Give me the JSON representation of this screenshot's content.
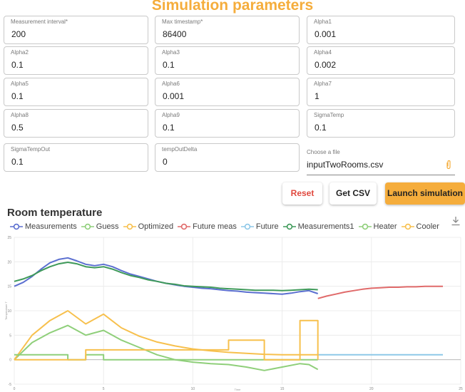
{
  "header": {
    "title": "Simulation parameters"
  },
  "fields": [
    {
      "label": "Measurement interval*",
      "value": "200"
    },
    {
      "label": "Max timestamp*",
      "value": "86400"
    },
    {
      "label": "Alpha1",
      "value": "0.001"
    },
    {
      "label": "Alpha2",
      "value": "0.1"
    },
    {
      "label": "Alpha3",
      "value": "0.1"
    },
    {
      "label": "Alpha4",
      "value": "0.002"
    },
    {
      "label": "Alpha5",
      "value": "0.1"
    },
    {
      "label": "Alpha6",
      "value": "0.001"
    },
    {
      "label": "Alpha7",
      "value": "1"
    },
    {
      "label": "Alpha8",
      "value": "0.5"
    },
    {
      "label": "Alpha9",
      "value": "0.1"
    },
    {
      "label": "SigmaTemp",
      "value": "0.1"
    },
    {
      "label": "SigmaTempOut",
      "value": "0.1"
    },
    {
      "label": "tempOutDelta",
      "value": "0"
    }
  ],
  "file": {
    "label": "Choose a file",
    "value": "inputTwoRooms.csv",
    "icon": "paperclip-icon"
  },
  "buttons": {
    "reset": "Reset",
    "get_csv": "Get CSV",
    "launch": "Launch simulation"
  },
  "colors": {
    "accent": "#f5ad3c",
    "reset": "#e0483e"
  },
  "chart_data": {
    "type": "line",
    "title": "Room temperature",
    "ylabel": "Temperature T",
    "xlabel": "Time",
    "xlim": [
      0,
      25
    ],
    "ylim": [
      -5,
      25
    ],
    "x_ticks": [
      "0",
      "5",
      "10",
      "15",
      "20",
      "25"
    ],
    "y_ticks": [
      "-5",
      "0",
      "5",
      "10",
      "15",
      "20",
      "25"
    ],
    "legend_position": "top",
    "series": [
      {
        "name": "Measurements",
        "color": "#5b6fd0",
        "x": [
          0,
          0.5,
          1,
          1.5,
          2,
          2.5,
          3,
          3.5,
          4,
          4.5,
          5,
          5.5,
          6,
          6.5,
          7,
          7.5,
          8,
          8.5,
          9,
          9.5,
          10,
          10.5,
          11,
          11.5,
          12,
          12.5,
          13,
          13.5,
          14,
          14.5,
          15,
          15.5,
          16,
          16.5,
          17
        ],
        "y": [
          15,
          15.8,
          17,
          18.5,
          19.8,
          20.5,
          20.8,
          20.2,
          19.5,
          19.2,
          19.5,
          19,
          18.2,
          17.5,
          17,
          16.5,
          16,
          15.6,
          15.3,
          15,
          14.8,
          14.6,
          14.5,
          14.3,
          14.1,
          14,
          13.8,
          13.7,
          13.6,
          13.5,
          13.4,
          13.6,
          13.9,
          14.1,
          13.5
        ]
      },
      {
        "name": "Guess",
        "color": "#8fcf7a",
        "x": [
          0,
          1,
          2,
          3,
          4,
          5,
          6,
          7,
          8,
          9,
          10,
          11,
          12,
          13,
          14,
          15,
          16,
          16.5,
          17
        ],
        "y": [
          0,
          3.5,
          5.5,
          7,
          5,
          6,
          4,
          2.5,
          1,
          0,
          -0.5,
          -0.8,
          -1,
          -1.5,
          -2.2,
          -1.5,
          -0.8,
          -1,
          -2
        ]
      },
      {
        "name": "Optimized",
        "color": "#f7c04d",
        "x": [
          0,
          1,
          2,
          3,
          4,
          5,
          6,
          7,
          8,
          9,
          10,
          11,
          12,
          13,
          14,
          15,
          16,
          17
        ],
        "y": [
          0,
          5,
          8,
          10,
          7.3,
          9.3,
          6.5,
          4.8,
          3.6,
          2.8,
          2.2,
          1.8,
          1.5,
          1.3,
          1.1,
          1,
          1,
          1
        ]
      },
      {
        "name": "Future meas",
        "color": "#e06a6a",
        "x": [
          17,
          17.5,
          18,
          18.5,
          19,
          19.5,
          20,
          20.5,
          21,
          21.5,
          22,
          22.5,
          23,
          23.5,
          24
        ],
        "y": [
          12.5,
          13,
          13.4,
          13.8,
          14.1,
          14.4,
          14.6,
          14.7,
          14.8,
          14.8,
          14.9,
          14.9,
          15,
          15,
          15
        ]
      },
      {
        "name": "Future",
        "color": "#8ec8e8",
        "x": [
          17,
          18,
          19,
          20,
          21,
          22,
          23,
          24
        ],
        "y": [
          1,
          1,
          1,
          1,
          1,
          1,
          1,
          1
        ]
      },
      {
        "name": "Measurements1",
        "color": "#3f9a5a",
        "x": [
          0,
          0.5,
          1,
          1.5,
          2,
          2.5,
          3,
          3.5,
          4,
          4.5,
          5,
          5.5,
          6,
          6.5,
          7,
          7.5,
          8,
          8.5,
          9,
          9.5,
          10,
          10.5,
          11,
          11.5,
          12,
          12.5,
          13,
          13.5,
          14,
          14.5,
          15,
          15.5,
          16,
          16.5,
          17
        ],
        "y": [
          16,
          16.5,
          17.2,
          18.2,
          19,
          19.6,
          19.9,
          19.6,
          19,
          18.8,
          19,
          18.5,
          17.8,
          17.2,
          16.8,
          16.3,
          16,
          15.6,
          15.4,
          15.1,
          15,
          14.9,
          14.8,
          14.6,
          14.5,
          14.4,
          14.3,
          14.2,
          14.2,
          14.2,
          14.1,
          14.2,
          14.3,
          14.4,
          14.3
        ]
      },
      {
        "name": "Heater",
        "color": "#8fcf7a",
        "x": [
          0,
          3,
          3,
          4,
          4,
          5,
          5,
          17
        ],
        "y": [
          1,
          1,
          0,
          0,
          1,
          1,
          0,
          0
        ]
      },
      {
        "name": "Cooler",
        "color": "#f7c04d",
        "x": [
          0,
          4,
          4,
          12,
          12,
          14,
          14,
          16,
          16,
          17,
          17
        ],
        "y": [
          0,
          0,
          2,
          2,
          4,
          4,
          0,
          0,
          8,
          8,
          0
        ]
      }
    ]
  }
}
